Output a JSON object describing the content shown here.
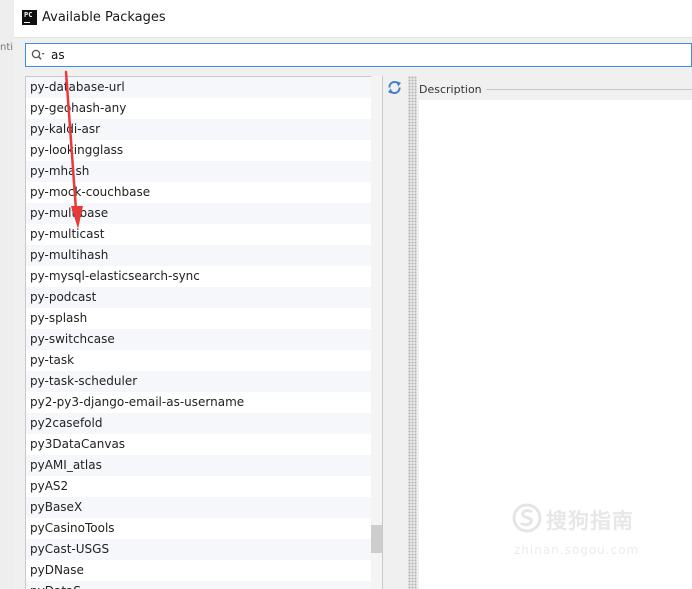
{
  "window": {
    "title": "Available Packages",
    "app_icon_text": "PC",
    "background_edge_text": "nti"
  },
  "search": {
    "value": "as",
    "icon": "search-icon"
  },
  "packages": [
    "py-database-url",
    "py-geohash-any",
    "py-kaldi-asr",
    "py-lookingglass",
    "py-mhash",
    "py-mock-couchbase",
    "py-multibase",
    "py-multicast",
    "py-multihash",
    "py-mysql-elasticsearch-sync",
    "py-podcast",
    "py-splash",
    "py-switchcase",
    "py-task",
    "py-task-scheduler",
    "py2-py3-django-email-as-username",
    "py2casefold",
    "py3DataCanvas",
    "pyAMI_atlas",
    "pyAS2",
    "pyBaseX",
    "pyCasinoTools",
    "pyCast-USGS",
    "pyDNase",
    "pyDataS"
  ],
  "details": {
    "description_label": "Description"
  },
  "icons": {
    "refresh": "refresh-icon",
    "annotation": "red-arrow"
  },
  "colors": {
    "accent": "#3d8ee0",
    "refresh": "#3d7fc8",
    "annotation_arrow": "#e83a3a"
  },
  "watermark": {
    "text": "搜狗指南",
    "url": "zhinan.sogou.com"
  }
}
